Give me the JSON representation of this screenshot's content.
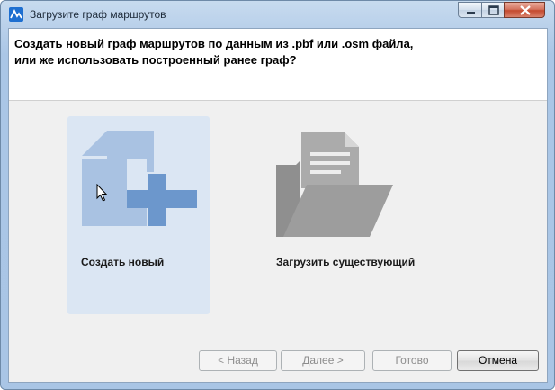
{
  "window": {
    "title": "Загрузите граф маршрутов",
    "icons": {
      "app": "app-logo-icon",
      "minimize": "minimize-icon",
      "maximize": "maximize-icon",
      "close": "close-icon"
    }
  },
  "header": {
    "line1": "Создать новый граф маршрутов по данным из .pbf или .osm файла,",
    "line2": "или же использовать построенный ранее граф?"
  },
  "options": {
    "create": {
      "label": "Создать новый",
      "icon": "new-document-icon",
      "selected": true
    },
    "load": {
      "label": "Загрузить существующий",
      "icon": "open-folder-icon",
      "selected": false
    }
  },
  "buttons": {
    "back": "< Назад",
    "next": "Далее >",
    "done": "Готово",
    "cancel": "Отмена"
  },
  "colors": {
    "selection": "#dbe6f3",
    "create_icon_light": "#a9c2e2",
    "create_icon_dark": "#6c97cc",
    "folder_icon": "#9a9a9a"
  }
}
